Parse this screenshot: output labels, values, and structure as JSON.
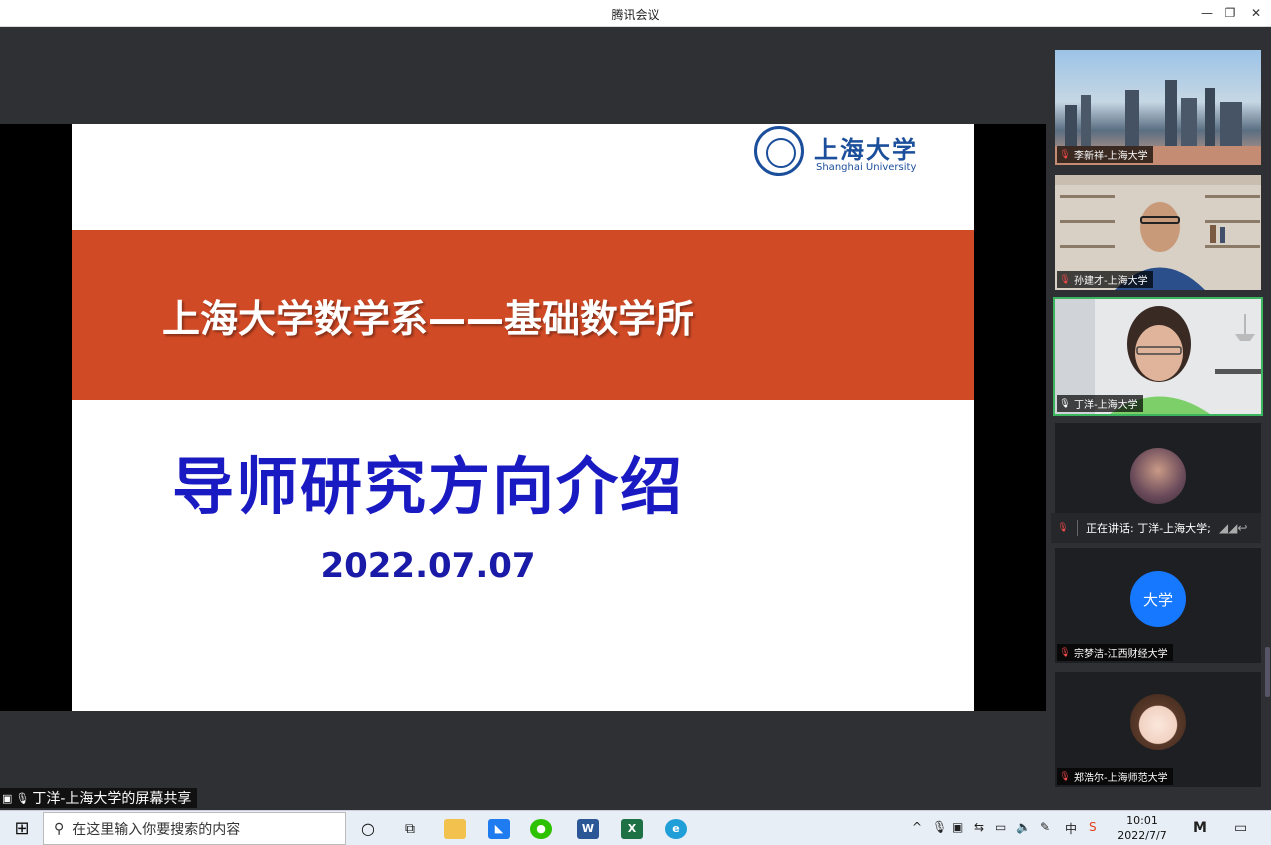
{
  "window": {
    "title": "腾讯会议"
  },
  "slide": {
    "logo_cn": "上海大学",
    "logo_en": "Shanghai University",
    "band_text": "上海大学数学系——基础数学所",
    "title": "导师研究方向介绍",
    "date": "2022.07.07"
  },
  "share_label": "丁洋-上海大学的屏幕共享",
  "participants": [
    {
      "name": "李新祥-上海大学",
      "muted": true
    },
    {
      "name": "孙建才-上海大学",
      "muted": true
    },
    {
      "name": "丁洋-上海大学",
      "muted": false
    },
    {
      "name": "",
      "muted": true
    },
    {
      "name": "宗梦洁-江西财经大学",
      "muted": true,
      "avatar_text": "大学"
    },
    {
      "name": "郑浩尔-上海师范大学",
      "muted": true
    }
  ],
  "speaking": "正在讲话: 丁洋-上海大学;",
  "taskbar": {
    "search_placeholder": "在这里输入你要搜索的内容",
    "time": "10:01",
    "date": "2022/7/7",
    "ime": "中"
  },
  "colors": {
    "band": "#d14a26",
    "title": "#1a1ac2",
    "brand": "#1b4e9b",
    "active": "#3bb55e",
    "avatar_blue": "#1677ff"
  }
}
